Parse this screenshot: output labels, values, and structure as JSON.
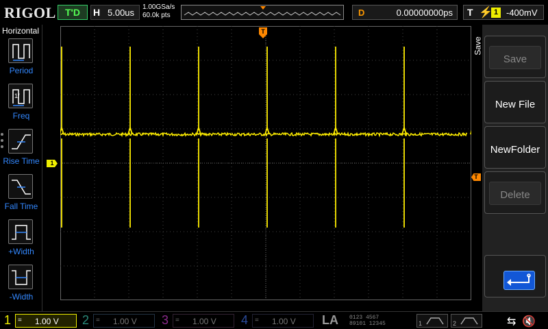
{
  "brand": "RIGOL",
  "status": {
    "run_state": "T'D",
    "horizontal_key": "H",
    "timebase": "5.00us",
    "sample_rate": "1.00GSa/s",
    "memory_depth": "60.0k pts",
    "delay_key": "D",
    "delay": "0.00000000ps",
    "trigger_key": "T",
    "trigger_edge_icon": "rising-edge-icon",
    "trigger_source": "1",
    "trigger_level": "-400mV"
  },
  "left_panel": {
    "title": "Horizontal",
    "items": [
      {
        "label": "Period",
        "icon": "period-icon"
      },
      {
        "label": "Freq",
        "icon": "frequency-icon"
      },
      {
        "label": "Rise Time",
        "icon": "rise-time-icon"
      },
      {
        "label": "Fall Time",
        "icon": "fall-time-icon"
      },
      {
        "label": "+Width",
        "icon": "positive-width-icon"
      },
      {
        "label": "-Width",
        "icon": "negative-width-icon"
      }
    ]
  },
  "screen": {
    "ch1_marker": "1",
    "trigger_marker": "T",
    "trigger_level_marker": "T",
    "trace_color": "#ffee00",
    "spike_period_us": 5,
    "spike_count": 7
  },
  "menu": {
    "title": "Save",
    "keys": [
      {
        "label": "Save",
        "enabled": false
      },
      {
        "label": "New File",
        "enabled": true
      },
      {
        "label": "NewFolder",
        "enabled": true
      },
      {
        "label": "Delete",
        "enabled": false
      }
    ],
    "back_icon": "return-arrow-icon"
  },
  "channels": [
    {
      "num": "1",
      "coupling": "=",
      "scale": "1.00 V",
      "active": true,
      "color": "#ffee00"
    },
    {
      "num": "2",
      "coupling": "=",
      "scale": "1.00 V",
      "active": false,
      "color": "#2a8a7a"
    },
    {
      "num": "3",
      "coupling": "=",
      "scale": "1.00 V",
      "active": false,
      "color": "#8a2a8a"
    },
    {
      "num": "4",
      "coupling": "=",
      "scale": "1.00 V",
      "active": false,
      "color": "#2a4a9a"
    }
  ],
  "bottom": {
    "la_label": "LA",
    "la_digits": "0123 4567\n89101 12345",
    "decoder1": "1",
    "decoder2": "2"
  }
}
